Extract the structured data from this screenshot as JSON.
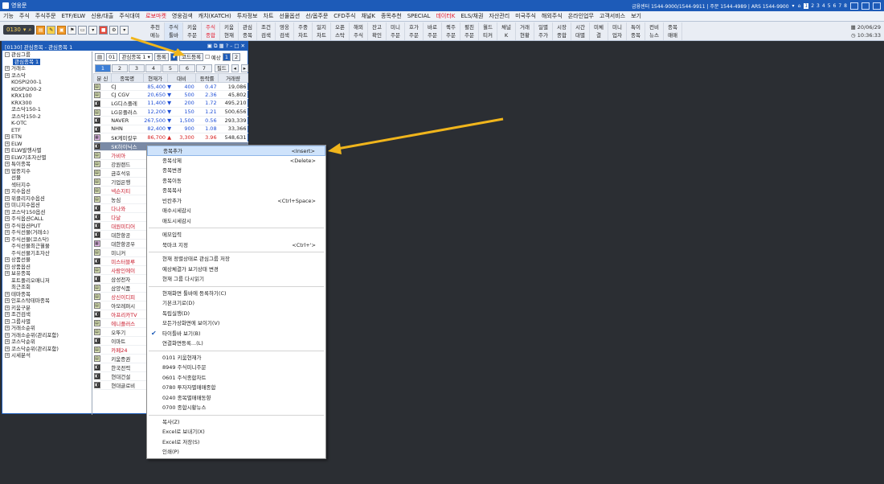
{
  "titlebar": {
    "title": "영웅문",
    "center": "금융센터 1544-9000/1544-9911 | 주문 1544-4989 | ARS 1544-9900",
    "pages": [
      "1",
      "2",
      "3",
      "4",
      "5",
      "6",
      "7",
      "8"
    ]
  },
  "menu": [
    "기능",
    "주식",
    "주식주문",
    "ETF/ELW",
    "신용/대출",
    "주식대여",
    "로보마켓",
    "영웅검색",
    "캐치(KATCH)",
    "투자정보",
    "차트",
    "선물옵션",
    "선/옵주문",
    "CFD주식",
    "채널K",
    "종목추천",
    "SPECIAL",
    "데이터K",
    "ELS/채권",
    "자산관리",
    "미국주식",
    "해외주식",
    "온라인업무",
    "고객서비스",
    "보기"
  ],
  "toolbar": {
    "screen_no": "0130",
    "quick": [
      "추천\n메뉴",
      "주식\n툴바",
      "키움\n주문",
      "주식\n종합",
      "키움\n현재",
      "관심\n종목",
      "조건\n검색",
      "영웅\n검색",
      "주중\n차트",
      "일지\n차트",
      "오픈\n스탁",
      "해외\n주식",
      "잔고\n확인",
      "미니\n주문",
      "호가\n주문",
      "바로\n주문",
      "퀵주\n주문",
      "펼친\n주문",
      "월드\n티커",
      "채널\nK",
      "거래\n현황",
      "일별\n주가",
      "시장\n종합",
      "시간\n대별",
      "미체\n결",
      "미니\n업자",
      "특이\n종목",
      "컨비\n뉴스",
      "종목\n매매"
    ],
    "date": "20/06/29",
    "time": "10:36:33"
  },
  "window": {
    "title": "[0130] 관심종목 - 관심종목 1",
    "group_select": "관심종목 1",
    "group_no": "01",
    "register_btn": "등록",
    "code_btn": "코드등록",
    "expect_label": "예상",
    "page_a": "1",
    "page_b": "2",
    "field_btn": "필드",
    "tabs": [
      "1",
      "2",
      "3",
      "4",
      "5",
      "6",
      "7"
    ]
  },
  "tree": [
    {
      "label": "관심그룹",
      "exp": "-"
    },
    {
      "label": "관심종목 1",
      "sel": true
    },
    {
      "label": "거래소",
      "exp": "+"
    },
    {
      "label": "코스닥",
      "exp": "+"
    },
    {
      "label": "KOSPI200-1"
    },
    {
      "label": "KOSPI200-2"
    },
    {
      "label": "KRX100"
    },
    {
      "label": "KRX300"
    },
    {
      "label": "코스닥150-1"
    },
    {
      "label": "코스닥150-2"
    },
    {
      "label": "K-OTC"
    },
    {
      "label": "ETF"
    },
    {
      "label": "ETN",
      "exp": "+"
    },
    {
      "label": "ELW",
      "exp": "+"
    },
    {
      "label": "ELW발행사별",
      "exp": "+"
    },
    {
      "label": "ELW기초자산별",
      "exp": "+"
    },
    {
      "label": "특이종목",
      "exp": "+"
    },
    {
      "label": "업종지수",
      "exp": "+"
    },
    {
      "label": "선물"
    },
    {
      "label": "섹터지수"
    },
    {
      "label": "지수옵션",
      "exp": "+"
    },
    {
      "label": "위클리지수옵션",
      "exp": "+"
    },
    {
      "label": "미니지수옵션",
      "exp": "+"
    },
    {
      "label": "코스닥150옵션",
      "exp": "+"
    },
    {
      "label": "주식옵션CALL",
      "exp": "+"
    },
    {
      "label": "주식옵션PUT",
      "exp": "+"
    },
    {
      "label": "주식선물(거래소)",
      "exp": "+"
    },
    {
      "label": "주식선물(코스닥)",
      "exp": "+"
    },
    {
      "label": "주식선물최근월물"
    },
    {
      "label": "주식선물기초자산"
    },
    {
      "label": "상품선물",
      "exp": "+"
    },
    {
      "label": "상품옵션",
      "exp": "+"
    },
    {
      "label": "보유종목",
      "exp": "+"
    },
    {
      "label": "포트폴리오매니저"
    },
    {
      "label": "최근조회"
    },
    {
      "label": "테마종목",
      "exp": "+"
    },
    {
      "label": "인포스탁테마종목",
      "exp": "+"
    },
    {
      "label": "키움구분",
      "exp": "+"
    },
    {
      "label": "조건검색",
      "exp": "+"
    },
    {
      "label": "그룹사별",
      "exp": "+"
    },
    {
      "label": "거래소순위",
      "exp": "+"
    },
    {
      "label": "거래소순위(관리포함)",
      "exp": "+"
    },
    {
      "label": "코스닥순위",
      "exp": "+"
    },
    {
      "label": "코스닥순위(관리포함)",
      "exp": "+"
    },
    {
      "label": "시세분석",
      "exp": "+"
    }
  ],
  "grid": {
    "headers": [
      "분 신",
      "종목명",
      "현재가",
      "대비",
      "등락률",
      "거래량"
    ],
    "rows": [
      {
        "mk": "g",
        "name": "CJ",
        "price": "85,400",
        "dir": "dn",
        "diff": "400",
        "rate": "0.47",
        "vol": "19,086"
      },
      {
        "mk": "g",
        "name": "CJ CGV",
        "price": "20,650",
        "dir": "dn",
        "diff": "500",
        "rate": "2.36",
        "vol": "45,802"
      },
      {
        "mk": "b",
        "name": "LG디스플레",
        "price": "11,400",
        "dir": "dn",
        "diff": "200",
        "rate": "1.72",
        "vol": "495,210"
      },
      {
        "mk": "g",
        "name": "LG유플러스",
        "price": "12,200",
        "dir": "dn",
        "diff": "150",
        "rate": "1.21",
        "vol": "500,656"
      },
      {
        "mk": "b",
        "name": "NAVER",
        "price": "267,500",
        "dir": "dn",
        "diff": "1,500",
        "rate": "0.56",
        "vol": "293,339"
      },
      {
        "mk": "b",
        "name": "NHN",
        "price": "82,400",
        "dir": "dn",
        "diff": "900",
        "rate": "1.08",
        "vol": "33,366"
      },
      {
        "mk": "p",
        "name": "SK케미칼우",
        "price": "86,700",
        "dir": "up",
        "diff": "3,300",
        "rate": "3.96",
        "vol": "548,631"
      },
      {
        "mk": "b",
        "name": "SK하이닉스",
        "price": "",
        "dir": "",
        "diff": "",
        "rate": "",
        "vol": "",
        "sel": true
      },
      {
        "mk": "g",
        "name": "가비아",
        "price": "",
        "red": true
      },
      {
        "mk": "g",
        "name": "강원랜드",
        "price": ""
      },
      {
        "mk": "g",
        "name": "금호석유",
        "price": ""
      },
      {
        "mk": "g",
        "name": "기업은행",
        "price": ""
      },
      {
        "mk": "g",
        "name": "넥슨지티",
        "price": "",
        "red": true
      },
      {
        "mk": "g",
        "name": "농심",
        "price": "3"
      },
      {
        "mk": "b",
        "name": "다나와",
        "price": "",
        "red": true
      },
      {
        "mk": "b",
        "name": "다날",
        "price": "",
        "red": true
      },
      {
        "mk": "b",
        "name": "대원미디어",
        "price": "",
        "red": true
      },
      {
        "mk": "b",
        "name": "대한항공",
        "price": ""
      },
      {
        "mk": "p",
        "name": "대한항공우",
        "price": ""
      },
      {
        "mk": "g",
        "name": "미니커",
        "price": ""
      },
      {
        "mk": "b",
        "name": "미스터블루",
        "price": "",
        "red": true
      },
      {
        "mk": "g",
        "name": "사람인에이",
        "price": "",
        "red": true
      },
      {
        "mk": "b",
        "name": "삼성전자",
        "price": ""
      },
      {
        "mk": "g",
        "name": "삼양식품",
        "price": "1"
      },
      {
        "mk": "g",
        "name": "상신이디피",
        "price": "",
        "red": true
      },
      {
        "mk": "g",
        "name": "아모레퍼시",
        "price": "1"
      },
      {
        "mk": "b",
        "name": "아프리카TV",
        "price": "",
        "red": true
      },
      {
        "mk": "g",
        "name": "에니플러스",
        "price": "",
        "red": true
      },
      {
        "mk": "g",
        "name": "오뚜기",
        "price": "5"
      },
      {
        "mk": "b",
        "name": "이마트",
        "price": "1"
      },
      {
        "mk": "g",
        "name": "카페24",
        "price": "",
        "red": true
      },
      {
        "mk": "g",
        "name": "키움증권",
        "price": ""
      },
      {
        "mk": "b",
        "name": "한국전력",
        "price": ""
      },
      {
        "mk": "b",
        "name": "현대건설",
        "price": ""
      },
      {
        "mk": "b",
        "name": "현대글로비",
        "price": ""
      }
    ]
  },
  "context_menu": [
    {
      "label": "종목추가",
      "shortcut": "<Insert>",
      "hl": true
    },
    {
      "label": "종목삭제",
      "shortcut": "<Delete>"
    },
    {
      "label": "종목변경"
    },
    {
      "label": "종목이동"
    },
    {
      "label": "종목복사"
    },
    {
      "label": "빈칸추가",
      "shortcut": "<Ctrl+Space>"
    },
    {
      "label": "매수시세감시"
    },
    {
      "label": "매도시세감시"
    },
    {
      "sep": true
    },
    {
      "label": "메모입력"
    },
    {
      "label": "북마크 지정",
      "shortcut": "<Ctrl+'>"
    },
    {
      "sep": true
    },
    {
      "label": "현재 정렬상태로 관심그룹 저장"
    },
    {
      "label": "예상체결가 보기상태 변경"
    },
    {
      "label": "현재 그룹 다시읽기"
    },
    {
      "sep": true
    },
    {
      "label": "현재화면 툴바에 등록하기(C)"
    },
    {
      "label": "기본크기로(D)"
    },
    {
      "label": "독립실행(D)"
    },
    {
      "label": "모든가상화면에 보이기(V)"
    },
    {
      "label": "타이틀바 보기(B)",
      "check": true
    },
    {
      "label": "연결화면등록...(L)"
    },
    {
      "sep": true
    },
    {
      "label": "0101 키움현재가"
    },
    {
      "label": "8949 주식미니주문"
    },
    {
      "label": "0601 주식종합차트"
    },
    {
      "label": "0780 투자자별매매종합"
    },
    {
      "label": "0240 종목별매매동향"
    },
    {
      "label": "0700 종합시황뉴스"
    },
    {
      "sep": true
    },
    {
      "label": "복사(Z)"
    },
    {
      "label": "Excel로 보내기(X)"
    },
    {
      "label": "Excel로 저장(S)"
    },
    {
      "label": "인쇄(P)"
    }
  ],
  "colors": {
    "accent": "#1d5bb8",
    "highlight": "#cfe3fb",
    "arrow": "#f0b51c",
    "up": "#d61f1f",
    "down": "#1f4fd6"
  }
}
